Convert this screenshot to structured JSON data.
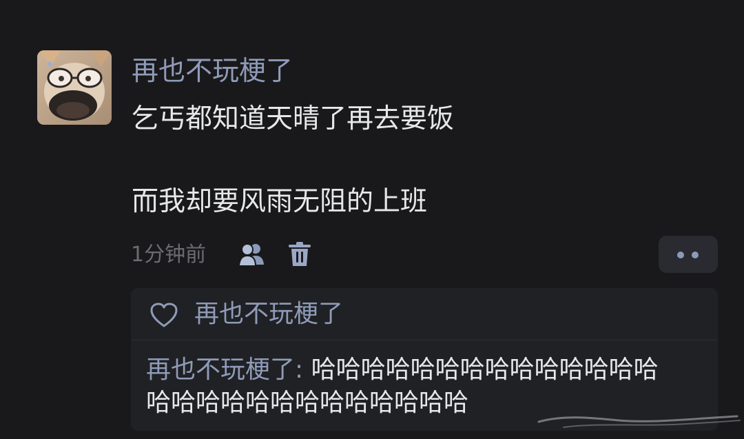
{
  "comment": {
    "username": "再也不玩梗了",
    "content_line1": "乞丐都知道天晴了再去要饭",
    "content_line2": "而我却要风雨无阻的上班",
    "time": "1分钟前"
  },
  "actions": {
    "people_icon": "people-icon",
    "delete_icon": "trash-icon",
    "more_icon": "more-dots-icon"
  },
  "reply_box": {
    "liked_by": "再也不玩梗了",
    "reply_author": "再也不玩梗了",
    "reply_sep": ": ",
    "reply_line1": "哈哈哈哈哈哈哈哈哈哈哈哈哈哈",
    "reply_line2": "哈哈哈哈哈哈哈哈哈哈哈哈哈"
  },
  "colors": {
    "background": "#19191b",
    "username": "#8f9bb8",
    "text": "#e7e8ea",
    "meta": "#6a6c71",
    "panel": "#202124"
  }
}
